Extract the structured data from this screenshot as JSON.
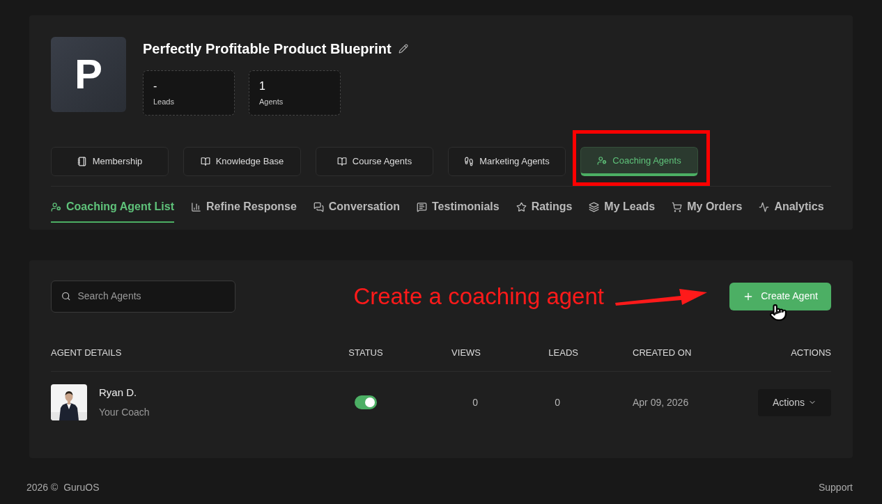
{
  "product": {
    "initial": "P",
    "title": "Perfectly Profitable Product Blueprint",
    "stats": [
      {
        "value": "-",
        "label": "Leads"
      },
      {
        "value": "1",
        "label": "Agents"
      }
    ]
  },
  "sections": [
    {
      "label": "Membership",
      "selected": false
    },
    {
      "label": "Knowledge Base",
      "selected": false
    },
    {
      "label": "Course Agents",
      "selected": false
    },
    {
      "label": "Marketing Agents",
      "selected": false
    },
    {
      "label": "Coaching Agents",
      "selected": true
    }
  ],
  "tabs": [
    {
      "label": "Coaching Agent List",
      "selected": true
    },
    {
      "label": "Refine Response",
      "selected": false
    },
    {
      "label": "Conversation",
      "selected": false
    },
    {
      "label": "Testimonials",
      "selected": false
    },
    {
      "label": "Ratings",
      "selected": false
    },
    {
      "label": "My Leads",
      "selected": false
    },
    {
      "label": "My Orders",
      "selected": false
    },
    {
      "label": "Analytics",
      "selected": false
    }
  ],
  "search": {
    "placeholder": "Search Agents"
  },
  "create_button": "Create Agent",
  "annotation": {
    "text": "Create a coaching agent"
  },
  "table": {
    "columns": [
      "AGENT DETAILS",
      "STATUS",
      "VIEWS",
      "LEADS",
      "CREATED ON",
      "ACTIONS"
    ],
    "rows": [
      {
        "name": "Ryan D.",
        "role": "Your Coach",
        "on": true,
        "views": "0",
        "leads": "0",
        "created": "Apr 09, 2026",
        "action": "Actions"
      }
    ]
  },
  "footer": {
    "copyright": "2026 ©  GuruOS",
    "link": "Support"
  }
}
